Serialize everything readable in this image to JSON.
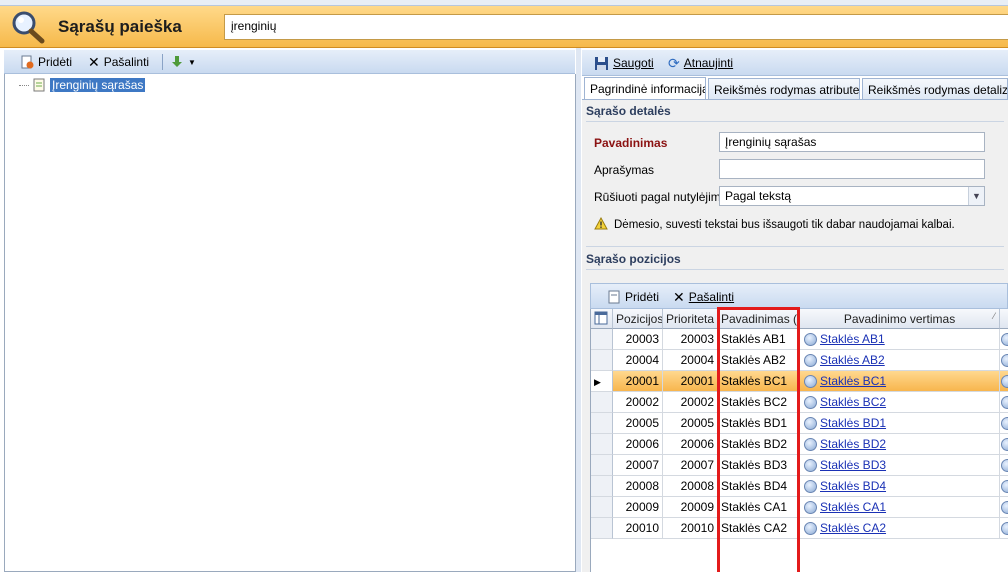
{
  "header": {
    "title": "Sąrašų paieška",
    "search_value": "įrenginių"
  },
  "left_toolbar": {
    "add": "Pridėti",
    "remove": "Pašalinti"
  },
  "tree": {
    "selected_item": "Įrenginių sąrašas"
  },
  "right_toolbar": {
    "save": "Saugoti",
    "refresh": "Atnaujinti"
  },
  "tabs": [
    "Pagrindinė informacija",
    "Reikšmės rodymas atribute",
    "Reikšmės rodymas detalizac"
  ],
  "details": {
    "section_title": "Sąrašo detalės",
    "name_label": "Pavadinimas",
    "name_value": "Įrenginių sąrašas",
    "description_label": "Aprašymas",
    "description_value": "",
    "sort_label": "Rūšiuoti pagal nutylėjimą",
    "sort_value": "Pagal tekstą",
    "warning": "Dėmesio, suvesti tekstai bus išsaugoti tik dabar naudojamai kalbai."
  },
  "positions": {
    "section_title": "Sąrašo pozicijos",
    "add": "Pridėti",
    "remove": "Pašalinti",
    "columns": [
      "Pozicijos",
      "Prioriteta",
      "Pavadinimas (i",
      "Pavadinimo vertimas"
    ],
    "rows": [
      {
        "pos": "20003",
        "prio": "20003",
        "name": "Staklės AB1",
        "trans": "Staklės AB1"
      },
      {
        "pos": "20004",
        "prio": "20004",
        "name": "Staklės AB2",
        "trans": "Staklės AB2"
      },
      {
        "pos": "20001",
        "prio": "20001",
        "name": "Staklės BC1",
        "trans": "Staklės BC1"
      },
      {
        "pos": "20002",
        "prio": "20002",
        "name": "Staklės BC2",
        "trans": "Staklės BC2"
      },
      {
        "pos": "20005",
        "prio": "20005",
        "name": "Staklės BD1",
        "trans": "Staklės BD1"
      },
      {
        "pos": "20006",
        "prio": "20006",
        "name": "Staklės BD2",
        "trans": "Staklės BD2"
      },
      {
        "pos": "20007",
        "prio": "20007",
        "name": "Staklės BD3",
        "trans": "Staklės BD3"
      },
      {
        "pos": "20008",
        "prio": "20008",
        "name": "Staklės BD4",
        "trans": "Staklės BD4"
      },
      {
        "pos": "20009",
        "prio": "20009",
        "name": "Staklės CA1",
        "trans": "Staklės CA1"
      },
      {
        "pos": "20010",
        "prio": "20010",
        "name": "Staklės CA2",
        "trans": "Staklės CA2"
      }
    ],
    "selected_row": 2
  },
  "colors": {
    "header_orange": "#f6b94a",
    "selection_blue": "#3e78c4",
    "highlight_red": "#e31b1b",
    "link_blue": "#1a31b5"
  }
}
